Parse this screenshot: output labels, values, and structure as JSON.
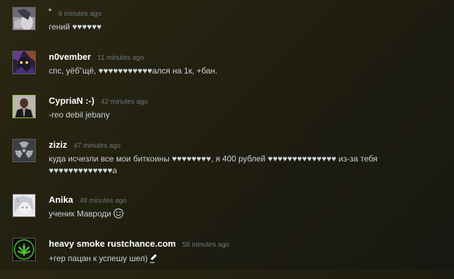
{
  "comments": [
    {
      "author": "˚",
      "time": "9 minutes ago",
      "text": "гений ♥♥♥♥♥♥",
      "avatar": "anime-girl-avatar"
    },
    {
      "author": "n0vember",
      "time": "11 minutes ago",
      "text": "спс, уёб\"щё, ♥♥♥♥♥♥♥♥♥♥♥ался на 1к, +бан.",
      "avatar": "purple-anime-avatar"
    },
    {
      "author": "CypriaN :-)",
      "time": "42 minutes ago",
      "text": "-reo debil jebany",
      "avatar": "man-in-suit-avatar"
    },
    {
      "author": "ziziz",
      "time": "47 minutes ago",
      "text": "куда исчезли все мои биткоины ♥♥♥♥♥♥♥♥, я 400 рублей ♥♥♥♥♥♥♥♥♥♥♥♥♥♥ из-за тебя ♥♥♥♥♥♥♥♥♥♥♥♥♥а",
      "avatar": "radiation-symbol-avatar"
    },
    {
      "author": "Anika",
      "time": "48 minutes ago",
      "text": "ученик Мавроди",
      "avatar": "white-hair-anime-avatar",
      "emoji": "smile-emoji-icon"
    },
    {
      "author": "heavy smoke rustchance.com",
      "time": "58 minutes ago",
      "text": "+гер пацан к успешу шел)",
      "avatar": "cannabis-leaf-avatar",
      "emoji": "pencil-emoji-icon"
    }
  ]
}
